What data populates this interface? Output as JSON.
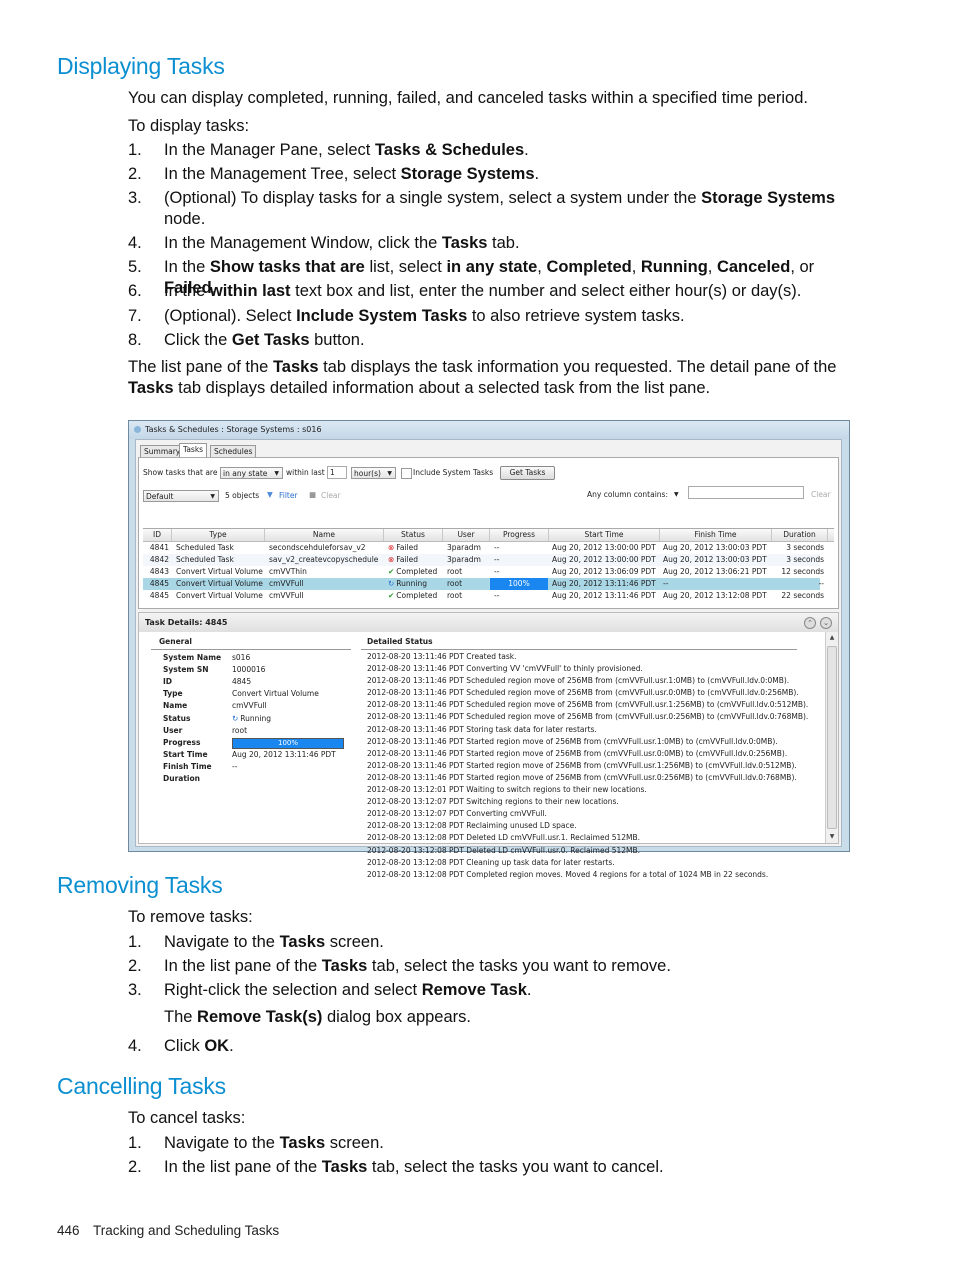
{
  "sections": {
    "displaying": {
      "title": "Displaying Tasks",
      "intro": "You can display completed, running, failed, and canceled tasks within a specified time period.",
      "lead": "To display tasks:",
      "steps": [
        {
          "num": "1.",
          "parts": [
            "In the Manager Pane, select ",
            "**Tasks & Schedules",
            "."
          ]
        },
        {
          "num": "2.",
          "parts": [
            "In the Management Tree, select ",
            "**Storage Systems",
            "."
          ]
        },
        {
          "num": "3.",
          "parts": [
            "(Optional) To display tasks for a single system, select a system under the ",
            "**Storage Systems",
            " node."
          ]
        },
        {
          "num": "4.",
          "parts": [
            "In the Management Window, click the ",
            "**Tasks",
            " tab."
          ]
        },
        {
          "num": "5.",
          "parts": [
            "In the ",
            "**Show tasks that are",
            " list, select ",
            "**in any state",
            ", ",
            "**Completed",
            ", ",
            "**Running",
            ", ",
            "**Canceled",
            ", or ",
            "**Failed",
            "."
          ]
        },
        {
          "num": "6.",
          "parts": [
            "In the ",
            "**within last",
            " text box and list, enter the number and select either hour(s) or day(s)."
          ]
        },
        {
          "num": "7.",
          "parts": [
            "(Optional). Select ",
            "**Include System Tasks",
            " to also retrieve system tasks."
          ]
        },
        {
          "num": "8.",
          "parts": [
            "Click the ",
            "**Get Tasks",
            " button."
          ]
        }
      ],
      "after": [
        "The list pane of the ",
        "**Tasks",
        " tab displays the task information you requested. The detail pane of the ",
        "**Tasks",
        " tab displays detailed information about a selected task from the list pane."
      ]
    },
    "removing": {
      "title": "Removing Tasks",
      "lead": "To remove tasks:",
      "steps": [
        {
          "num": "1.",
          "parts": [
            "Navigate to the ",
            "**Tasks",
            " screen."
          ]
        },
        {
          "num": "2.",
          "parts": [
            "In the list pane of the ",
            "**Tasks",
            " tab, select the tasks you want to remove."
          ]
        },
        {
          "num": "3.",
          "parts": [
            "Right-click the selection and select ",
            "**Remove Task",
            "."
          ]
        },
        {
          "num": "",
          "parts": [
            "The ",
            "**Remove Task(s)",
            " dialog box appears."
          ]
        },
        {
          "num": "4.",
          "parts": [
            "Click ",
            "**OK",
            "."
          ]
        }
      ]
    },
    "cancelling": {
      "title": "Cancelling Tasks",
      "lead": "To cancel tasks:",
      "steps": [
        {
          "num": "1.",
          "parts": [
            "Navigate to the ",
            "**Tasks",
            " screen."
          ]
        },
        {
          "num": "2.",
          "parts": [
            "In the list pane of the ",
            "**Tasks",
            " tab, select the tasks you want to cancel."
          ]
        }
      ]
    }
  },
  "footer": {
    "page": "446",
    "chapter": "Tracking and Scheduling Tasks"
  },
  "screenshot": {
    "window_title": "Tasks & Schedules : Storage Systems : s016",
    "tabs": [
      "Summary",
      "Tasks",
      "Schedules"
    ],
    "active_tab": "Tasks",
    "filter": {
      "show_label": "Show tasks that are",
      "state_value": "in any state",
      "within_label": "within last",
      "within_value": "1",
      "unit_value": "hour(s)",
      "include_system_label": "Include System Tasks",
      "include_system_checked": false,
      "get_tasks_label": "Get Tasks"
    },
    "toolbar": {
      "view_value": "Default",
      "count": "5 objects",
      "filter_label": "Filter",
      "clear_label": "Clear",
      "any_column_label": "Any column contains:",
      "search_value": "",
      "search_clear_label": "Clear"
    },
    "columns": [
      "ID",
      "Type",
      "Name",
      "Status",
      "User",
      "Progress",
      "Start Time",
      "Finish Time",
      "Duration"
    ],
    "rows": [
      {
        "id": "4841",
        "type": "Scheduled Task",
        "name": "secondscehduleforsav_v2",
        "status": "Failed",
        "status_kind": "failed",
        "user": "3paradm",
        "progress": "--",
        "start": "Aug 20, 2012 13:00:00 PDT",
        "finish": "Aug 20, 2012 13:00:03 PDT",
        "duration": "3 seconds"
      },
      {
        "id": "4842",
        "type": "Scheduled Task",
        "name": "sav_v2_createvcopyschedule",
        "status": "Failed",
        "status_kind": "failed",
        "user": "3paradm",
        "progress": "--",
        "start": "Aug 20, 2012 13:00:00 PDT",
        "finish": "Aug 20, 2012 13:00:03 PDT",
        "duration": "3 seconds"
      },
      {
        "id": "4843",
        "type": "Convert Virtual Volume",
        "name": "cmVVThin",
        "status": "Completed",
        "status_kind": "completed",
        "user": "root",
        "progress": "--",
        "start": "Aug 20, 2012 13:06:09 PDT",
        "finish": "Aug 20, 2012 13:06:21 PDT",
        "duration": "12 seconds"
      },
      {
        "id": "4845",
        "type": "Convert Virtual Volume",
        "name": "cmVVFull",
        "status": "Running",
        "status_kind": "running",
        "user": "root",
        "progress": "100%",
        "start": "Aug 20, 2012 13:11:46 PDT",
        "finish": "--",
        "duration": "--",
        "selected": true
      },
      {
        "id": "4845",
        "type": "Convert Virtual Volume",
        "name": "cmVVFull",
        "status": "Completed",
        "status_kind": "completed",
        "user": "root",
        "progress": "--",
        "start": "Aug 20, 2012 13:11:46 PDT",
        "finish": "Aug 20, 2012 13:12:08 PDT",
        "duration": "22 seconds"
      }
    ],
    "details": {
      "title": "Task Details: 4845",
      "general_title": "General",
      "detailed_status_title": "Detailed Status",
      "general": [
        {
          "key": "System Name",
          "value": "s016"
        },
        {
          "key": "System SN",
          "value": "1000016"
        },
        {
          "key": "ID",
          "value": "4845"
        },
        {
          "key": "Type",
          "value": "Convert Virtual Volume"
        },
        {
          "key": "Name",
          "value": "cmVVFull"
        },
        {
          "key": "Status",
          "value": "Running"
        },
        {
          "key": "User",
          "value": "root"
        },
        {
          "key": "Progress",
          "value": "100%"
        },
        {
          "key": "Start Time",
          "value": "Aug 20, 2012 13:11:46 PDT"
        },
        {
          "key": "Finish Time",
          "value": "--"
        },
        {
          "key": "Duration",
          "value": ""
        }
      ],
      "log": [
        "2012-08-20 13:11:46 PDT Created task.",
        "2012-08-20 13:11:46 PDT Converting VV 'cmVVFull' to thinly provisioned.",
        "2012-08-20 13:11:46 PDT Scheduled region move of 256MB from (cmVVFull.usr.1:0MB) to (cmVVFull.ldv.0:0MB).",
        "2012-08-20 13:11:46 PDT Scheduled region move of 256MB from (cmVVFull.usr.0:0MB) to (cmVVFull.ldv.0:256MB).",
        "2012-08-20 13:11:46 PDT Scheduled region move of 256MB from (cmVVFull.usr.1:256MB) to (cmVVFull.ldv.0:512MB).",
        "2012-08-20 13:11:46 PDT Scheduled region move of 256MB from (cmVVFull.usr.0:256MB) to (cmVVFull.ldv.0:768MB).",
        "2012-08-20 13:11:46 PDT Storing task data for later restarts.",
        "2012-08-20 13:11:46 PDT Started region move of 256MB from (cmVVFull.usr.1:0MB) to (cmVVFull.ldv.0:0MB).",
        "2012-08-20 13:11:46 PDT Started region move of 256MB from (cmVVFull.usr.0:0MB) to (cmVVFull.ldv.0:256MB).",
        "2012-08-20 13:11:46 PDT Started region move of 256MB from (cmVVFull.usr.1:256MB) to (cmVVFull.ldv.0:512MB).",
        "2012-08-20 13:11:46 PDT Started region move of 256MB from (cmVVFull.usr.0:256MB) to (cmVVFull.ldv.0:768MB).",
        "2012-08-20 13:12:01 PDT Waiting to switch regions to their new locations.",
        "2012-08-20 13:12:07 PDT Switching regions to their new locations.",
        "2012-08-20 13:12:07 PDT Converting cmVVFull.",
        "2012-08-20 13:12:08 PDT Reclaiming unused LD space.",
        "2012-08-20 13:12:08 PDT Deleted LD cmVVFull.usr.1. Reclaimed 512MB.",
        "2012-08-20 13:12:08 PDT Deleted LD cmVVFull.usr.0. Reclaimed 512MB.",
        "2012-08-20 13:12:08 PDT Cleaning up task data for later restarts.",
        "2012-08-20 13:12:08 PDT Completed region moves. Moved 4 regions for a total of 1024 MB in 22 seconds."
      ]
    }
  }
}
